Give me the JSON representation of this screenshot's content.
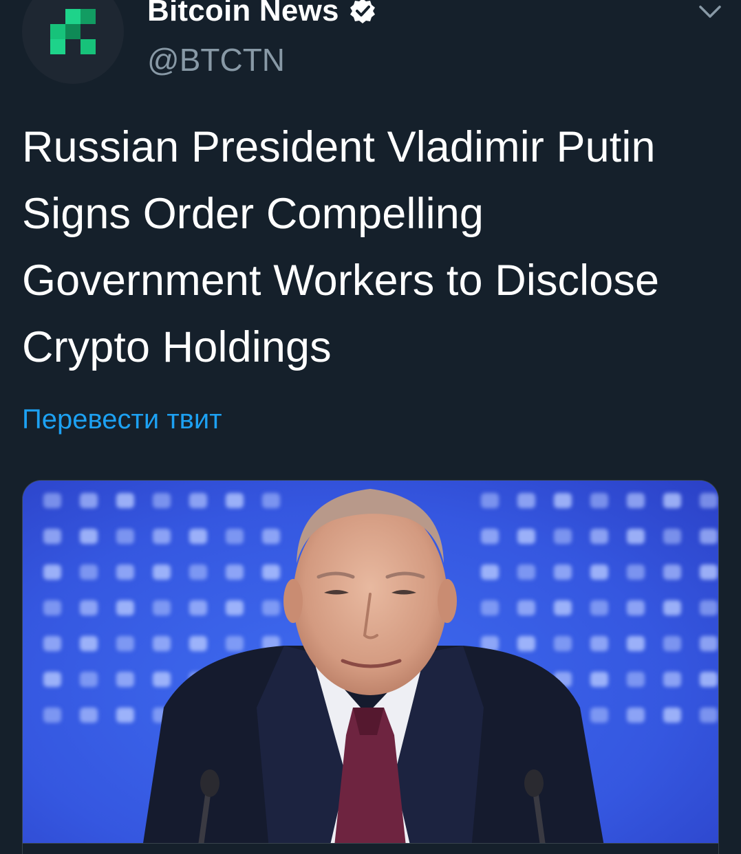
{
  "author": {
    "display_name": "Bitcoin News",
    "handle": "@BTCTN",
    "verified": true,
    "avatar_icon": "bitcoin-news-logo-icon"
  },
  "menu": {
    "icon": "chevron-down-icon"
  },
  "tweet": {
    "text": "Russian President Vladimir Putin Signs Order Compelling Government Workers to Disclose Crypto Holdings",
    "translate_label": "Перевести твит"
  },
  "media": {
    "kind": "photo"
  },
  "colors": {
    "background": "#15202b",
    "text_primary": "#ffffff",
    "text_secondary": "#8899a6",
    "link": "#1da1f2",
    "logo_green": "#17c27a"
  }
}
